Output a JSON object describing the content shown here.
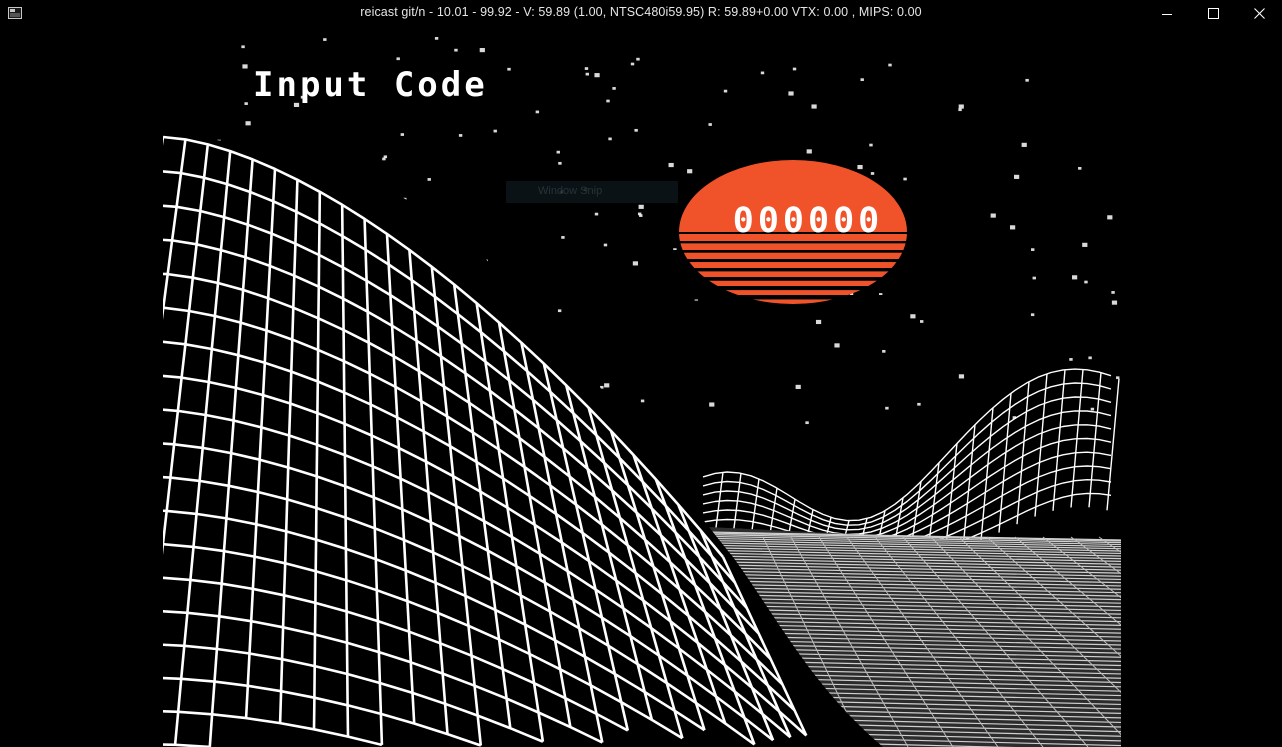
{
  "window": {
    "title": "reicast git/n - 10.01 - 99.92 - V: 59.89 (1.00, NTSC480i59.95) R: 59.89+0.00 VTX: 0.00 , MIPS: 0.00"
  },
  "game": {
    "heading": "Input Code",
    "code_value": "000000",
    "overlay_label": "Window Snip"
  },
  "colors": {
    "sun": "#f0532a",
    "grid": "#ffffff",
    "background": "#000000"
  },
  "icons": {
    "app": "app-icon",
    "minimize": "minimize-icon",
    "maximize": "maximize-icon",
    "close": "close-icon"
  }
}
